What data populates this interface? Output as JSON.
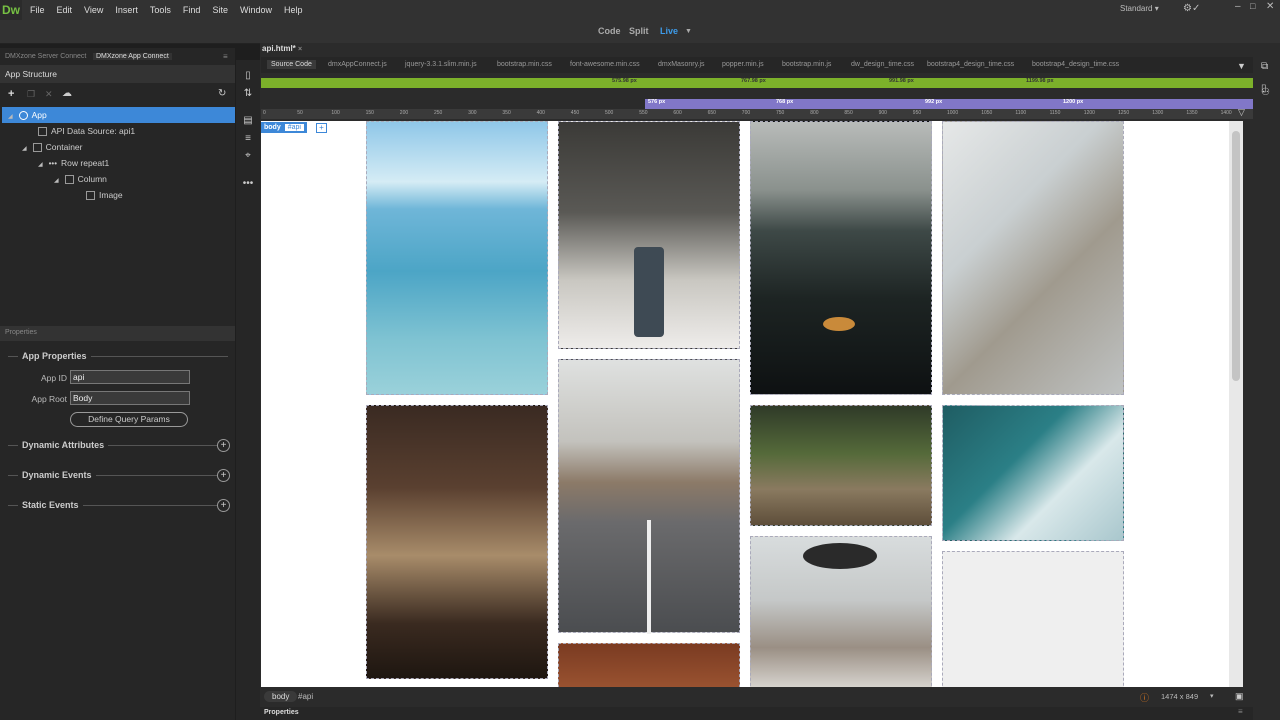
{
  "app": {
    "logo": "Dw"
  },
  "menu": [
    "File",
    "Edit",
    "View",
    "Insert",
    "Tools",
    "Find",
    "Site",
    "Window",
    "Help"
  ],
  "workspace": "Standard",
  "views": {
    "code": "Code",
    "split": "Split",
    "live": "Live"
  },
  "panel_tabs": [
    "DMXzone Server Connect",
    "DMXzone App Connect"
  ],
  "app_structure": {
    "title": "App Structure",
    "items": [
      {
        "label": "App"
      },
      {
        "label": "API Data Source: api1"
      },
      {
        "label": "Container"
      },
      {
        "label": "Row repeat1"
      },
      {
        "label": "Column"
      },
      {
        "label": "Image"
      }
    ]
  },
  "properties": {
    "title": "Properties",
    "section": "App Properties",
    "app_id_label": "App ID",
    "app_id_value": "api",
    "app_root_label": "App Root",
    "app_root_value": "Body",
    "define_button": "Define Query Params",
    "dynamic_attributes": "Dynamic Attributes",
    "dynamic_events": "Dynamic Events",
    "static_events": "Static Events"
  },
  "document": {
    "tab": "api.html*",
    "related_files": [
      "Source Code",
      "dmxAppConnect.js",
      "jquery-3.3.1.slim.min.js",
      "bootstrap.min.css",
      "font-awesome.min.css",
      "dmxMasonry.js",
      "popper.min.js",
      "bootstrap.min.js",
      "dw_design_time.css",
      "bootstrap4_design_time.css",
      "bootstrap4_design_time.css"
    ]
  },
  "breakpoints": [
    "575.98 px",
    "767.98 px",
    "991.98 px",
    "1199.98 px"
  ],
  "media_queries": [
    "576 px",
    "768 px",
    "992 px",
    "1200 px"
  ],
  "ruler": [
    "0",
    "50",
    "100",
    "150",
    "200",
    "250",
    "300",
    "350",
    "400",
    "450",
    "500",
    "550",
    "600",
    "650",
    "700",
    "750",
    "800",
    "850",
    "900",
    "950",
    "1000",
    "1050",
    "1100",
    "1150",
    "1200",
    "1250",
    "1300",
    "1350",
    "1400"
  ],
  "tag_chip": {
    "tag": "body",
    "id": "#api"
  },
  "status": {
    "tag": "body",
    "id": "#api",
    "size": "1474 x 849"
  },
  "bottom_panel": "Properties"
}
